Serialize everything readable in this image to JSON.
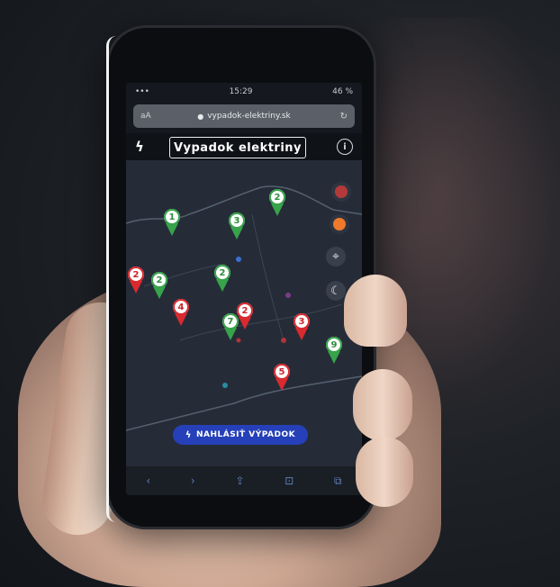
{
  "statusbar": {
    "time": "15:29",
    "battery": "46 %"
  },
  "browser": {
    "text_size": "aA",
    "url": "vypadok-elektriny.sk",
    "reload": "↻"
  },
  "app": {
    "title": "Vypadok elektriny",
    "bolt": "ϟ",
    "info": "i"
  },
  "pins": [
    {
      "color": "green",
      "count": "1"
    },
    {
      "color": "green",
      "count": "3"
    },
    {
      "color": "green",
      "count": "2"
    },
    {
      "color": "red",
      "count": "2"
    },
    {
      "color": "green",
      "count": "2"
    },
    {
      "color": "green",
      "count": "2"
    },
    {
      "color": "red",
      "count": "4"
    },
    {
      "color": "green",
      "count": "7"
    },
    {
      "color": "red",
      "count": "2"
    },
    {
      "color": "red",
      "count": "3"
    },
    {
      "color": "green",
      "count": "9"
    },
    {
      "color": "red",
      "count": "5"
    }
  ],
  "report_button": {
    "label": "NAHLÁSIŤ VÝPADOK",
    "icon": "ϟ"
  },
  "toolbar": {
    "back": "‹",
    "forward": "›",
    "share": "⇪",
    "bookmarks": "⊡",
    "tabs": "⧉"
  },
  "icons": [
    "bolt-icon",
    "info-icon",
    "locate-icon",
    "moon-icon",
    "lock-icon"
  ],
  "colors": {
    "outage": "#d92a2f",
    "restored": "#37a34a",
    "button": "#2540b8"
  }
}
